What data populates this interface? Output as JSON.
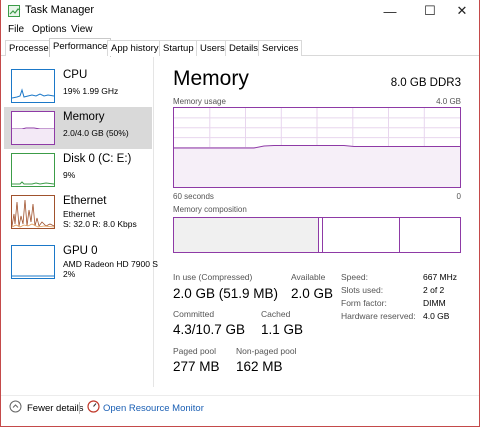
{
  "window": {
    "title": "Task Manager",
    "minimize": "—",
    "maximize": "☐",
    "close": "✕"
  },
  "menu": [
    "File",
    "Options",
    "View"
  ],
  "tabs": [
    "Processes",
    "Performance",
    "App history",
    "Startup",
    "Users",
    "Details",
    "Services"
  ],
  "active_tab": "Performance",
  "sidebar": [
    {
      "title": "CPU",
      "sub1": "19%  1.99 GHz",
      "sub2": ""
    },
    {
      "title": "Memory",
      "sub1": "2.0/4.0 GB (50%)",
      "sub2": ""
    },
    {
      "title": "Disk 0 (C: E:)",
      "sub1": "9%",
      "sub2": ""
    },
    {
      "title": "Ethernet",
      "sub1": "Ethernet",
      "sub2": "S: 32.0  R: 8.0 Kbps"
    },
    {
      "title": "GPU 0",
      "sub1": "AMD Radeon HD 7900 S",
      "sub2": "2%"
    }
  ],
  "selected_index": 1,
  "main": {
    "title": "Memory",
    "spec": "8.0 GB DDR3",
    "usage_label": "Memory usage",
    "usage_max": "4.0 GB",
    "axis_left": "60 seconds",
    "axis_right": "0",
    "composition_label": "Memory composition",
    "usage_level": 0.5
  },
  "stats": {
    "in_use_label": "In use (Compressed)",
    "in_use_value": "2.0 GB (51.9 MB)",
    "available_label": "Available",
    "available_value": "2.0 GB",
    "committed_label": "Committed",
    "committed_value": "4.3/10.7 GB",
    "cached_label": "Cached",
    "cached_value": "1.1 GB",
    "paged_label": "Paged pool",
    "paged_value": "277 MB",
    "nonpaged_label": "Non-paged pool",
    "nonpaged_value": "162 MB"
  },
  "details": [
    {
      "label": "Speed:",
      "value": "667 MHz"
    },
    {
      "label": "Slots used:",
      "value": "2 of 2"
    },
    {
      "label": "Form factor:",
      "value": "DIMM"
    },
    {
      "label": "Hardware reserved:",
      "value": "4.0 GB"
    }
  ],
  "footer": {
    "fewer_details": "Fewer details",
    "open_monitor": "Open Resource Monitor"
  },
  "colors": {
    "memory_accent": "#8e3aa6",
    "cpu_accent": "#1b78c8",
    "disk_accent": "#3c9c48",
    "ethernet_accent": "#a0522d",
    "gpu_accent": "#1b78c8"
  }
}
